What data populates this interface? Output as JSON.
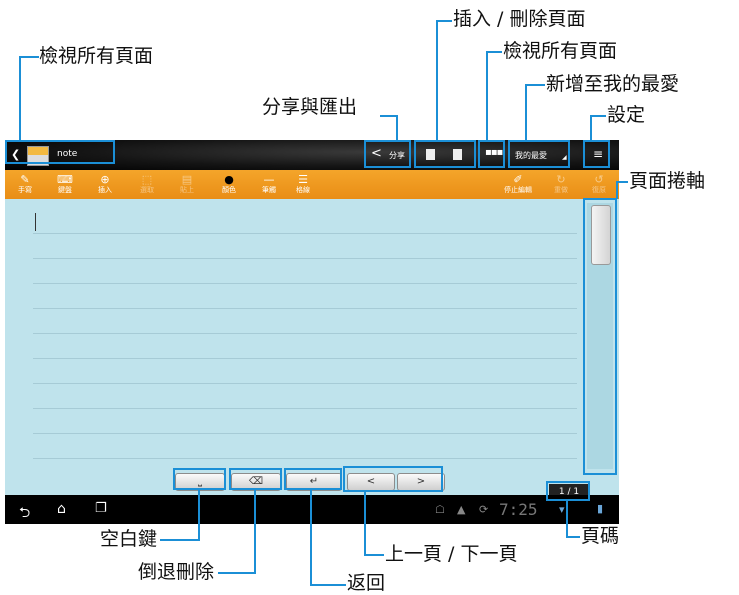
{
  "callouts": {
    "view_all_left": "檢視所有頁面",
    "insert_delete": "插入 / 刪除頁面",
    "view_all_right": "檢視所有頁面",
    "add_favorite": "新增至我的最愛",
    "settings": "設定",
    "share_export": "分享與匯出",
    "page_scroll": "頁面捲軸",
    "space_key": "空白鍵",
    "backspace": "倒退刪除",
    "return": "返回",
    "prev_next": "上一頁 / 下一頁",
    "page_number": "頁碼"
  },
  "topbar": {
    "back_icon": "❮",
    "note_title": "note",
    "share_label": "分享",
    "favorite_label": "我的最愛"
  },
  "toolbar": {
    "handwrite": "手寫",
    "keyboard": "鍵盤",
    "insert": "插入",
    "select": "選取",
    "paste": "貼上",
    "color": "顏色",
    "thickness": "筆觸",
    "ruled": "格線",
    "stop": "停止編輯",
    "redo": "重做",
    "undo": "復原"
  },
  "nav": {
    "prev": "<",
    "next": ">",
    "page_indicator": "1 / 1",
    "clock": "7:25"
  },
  "colors": {
    "accent": "#1b8fd6",
    "toolbar": "#f29b21",
    "page": "#bfe3ec"
  }
}
